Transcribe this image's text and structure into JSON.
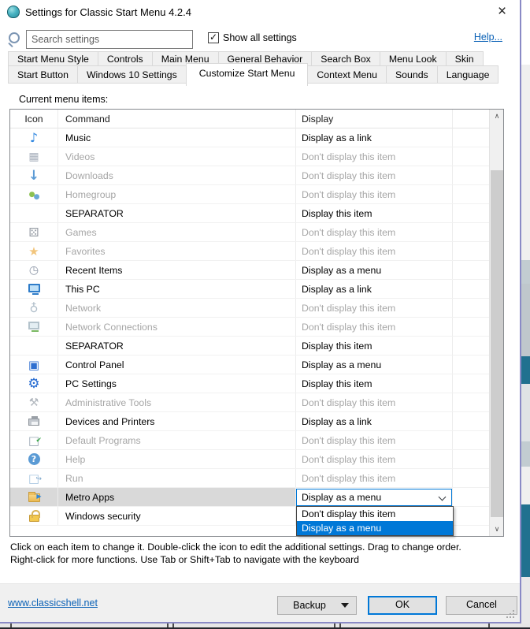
{
  "window": {
    "title": "Settings for Classic Start Menu 4.2.4",
    "close_glyph": "×"
  },
  "toolbar": {
    "search_placeholder": "Search settings",
    "show_all_label": "Show all settings",
    "show_all_checked": true,
    "help_label": "Help..."
  },
  "tabs": {
    "row1": [
      "Start Menu Style",
      "Controls",
      "Main Menu",
      "General Behavior",
      "Search Box",
      "Menu Look",
      "Skin"
    ],
    "row2": [
      "Start Button",
      "Windows 10 Settings",
      "Customize Start Menu",
      "Context Menu",
      "Sounds",
      "Language"
    ],
    "active": "Customize Start Menu"
  },
  "list": {
    "label": "Current menu items:",
    "columns": [
      "Icon",
      "Command",
      "Display"
    ],
    "rows": [
      {
        "icon": "music-note-icon",
        "command": "Music",
        "display": "Display as a link",
        "enabled": true
      },
      {
        "icon": "videos-icon",
        "command": "Videos",
        "display": "Don't display this item",
        "enabled": false
      },
      {
        "icon": "downloads-icon",
        "command": "Downloads",
        "display": "Don't display this item",
        "enabled": false
      },
      {
        "icon": "homegroup-icon",
        "command": "Homegroup",
        "display": "Don't display this item",
        "enabled": false
      },
      {
        "icon": "",
        "command": "SEPARATOR",
        "display": "Display this item",
        "enabled": true
      },
      {
        "icon": "games-icon",
        "command": "Games",
        "display": "Don't display this item",
        "enabled": false
      },
      {
        "icon": "favorites-icon",
        "command": "Favorites",
        "display": "Don't display this item",
        "enabled": false
      },
      {
        "icon": "recent-items-icon",
        "command": "Recent Items",
        "display": "Display as a menu",
        "enabled": true
      },
      {
        "icon": "this-pc-icon",
        "command": "This PC",
        "display": "Display as a link",
        "enabled": true
      },
      {
        "icon": "network-icon",
        "command": "Network",
        "display": "Don't display this item",
        "enabled": false
      },
      {
        "icon": "network-connections-icon",
        "command": "Network Connections",
        "display": "Don't display this item",
        "enabled": false
      },
      {
        "icon": "",
        "command": "SEPARATOR",
        "display": "Display this item",
        "enabled": true
      },
      {
        "icon": "control-panel-icon",
        "command": "Control Panel",
        "display": "Display as a menu",
        "enabled": true
      },
      {
        "icon": "pc-settings-icon",
        "command": "PC Settings",
        "display": "Display this item",
        "enabled": true
      },
      {
        "icon": "admin-tools-icon",
        "command": "Administrative Tools",
        "display": "Don't display this item",
        "enabled": false
      },
      {
        "icon": "devices-printers-icon",
        "command": "Devices and Printers",
        "display": "Display as a link",
        "enabled": true
      },
      {
        "icon": "default-programs-icon",
        "command": "Default Programs",
        "display": "Don't display this item",
        "enabled": false
      },
      {
        "icon": "help-icon",
        "command": "Help",
        "display": "Don't display this item",
        "enabled": false
      },
      {
        "icon": "run-icon",
        "command": "Run",
        "display": "Don't display this item",
        "enabled": false
      },
      {
        "icon": "metro-apps-icon",
        "command": "Metro Apps",
        "display": "Display as a menu",
        "enabled": true,
        "selected": true,
        "combobox": {
          "value": "Display as a menu",
          "open": true,
          "options": [
            {
              "label": "Don't display this item",
              "highlighted": false
            },
            {
              "label": "Display as a menu",
              "highlighted": true
            }
          ]
        }
      },
      {
        "icon": "windows-security-icon",
        "command": "Windows security",
        "display": "",
        "enabled": true
      }
    ]
  },
  "instructions": {
    "line1": "Click on each item to change it. Double-click the icon to edit the additional settings. Drag to change order.",
    "line2": "Right-click for more functions. Use Tab or Shift+Tab to navigate with the keyboard"
  },
  "footer": {
    "link": "www.classicshell.net",
    "backup_label": "Backup",
    "ok_label": "OK",
    "cancel_label": "Cancel"
  },
  "colors": {
    "accent": "#0078d7",
    "link": "#0a61b6",
    "disabled_text": "#a6a6a6",
    "row_highlight": "#d9d9d9",
    "window_border": "#8a8ac6"
  }
}
